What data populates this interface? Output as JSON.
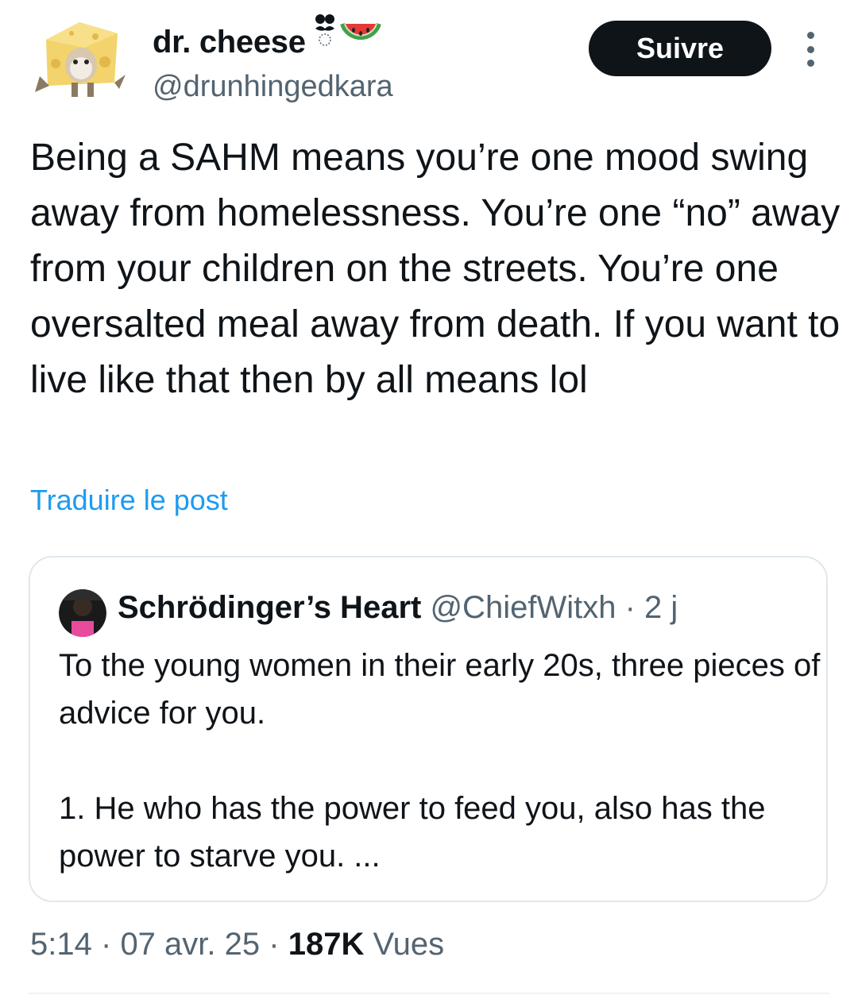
{
  "tweet": {
    "author": {
      "name": "dr. cheese",
      "handle": "@drunhingedkara",
      "name_icons": [
        "mustache-face-emoji-icon",
        "watermelon-emoji-icon"
      ]
    },
    "follow_label": "Suivre",
    "text": "Being a SAHM means you’re one mood swing away from homelessness. You’re one “no” away from your children on the streets. You’re one oversalted meal away from death. If you want to live like that then by all means lol",
    "translate_label": "Traduire le post",
    "quoted": {
      "name": "Schrödinger’s Heart",
      "handle": "@ChiefWitxh",
      "separator": "·",
      "age": "2 j",
      "text": "To the young women in their early 20s, three pieces of advice for you.\n\n1. He who has the power to feed you, also has the power to starve you.  ..."
    },
    "footer": {
      "time": "5:14",
      "date": "07 avr. 25",
      "views_count": "187K",
      "views_label": "Vues",
      "separator": "·"
    }
  },
  "colors": {
    "text": "#0f1419",
    "secondary": "#536471",
    "link": "#1d9bf0",
    "button_bg": "#0f1419",
    "border": "#e1e8ed"
  }
}
